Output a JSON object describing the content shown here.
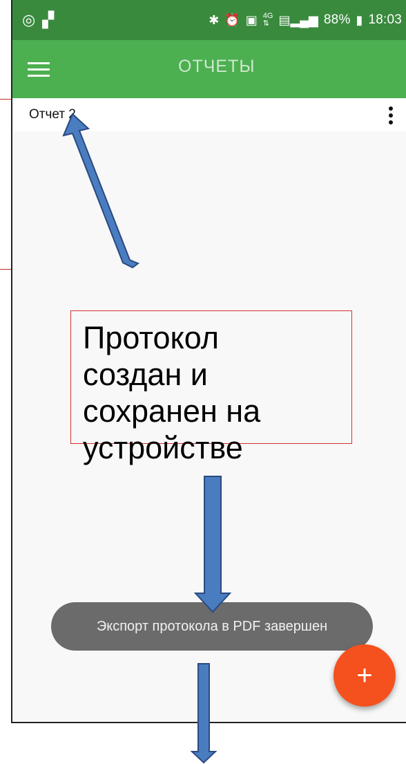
{
  "status_bar": {
    "left_icons": [
      "sync-icon",
      "app-notification-icon"
    ],
    "right_icons": [
      "bluetooth-icon",
      "alarm-icon",
      "sim-icon",
      "4g-icon",
      "signal-icon"
    ],
    "battery": "88%",
    "time": "18:03"
  },
  "app_bar": {
    "title": "ОТЧЕТЫ",
    "menu_icon": "hamburger-menu-icon"
  },
  "list": {
    "items": [
      {
        "label": "Отчет 2"
      }
    ],
    "overflow_icon": "more-vert-icon"
  },
  "toast": {
    "text": "Экспорт протокола в PDF завершен"
  },
  "fab": {
    "label": "+",
    "icon": "plus-icon"
  },
  "annotation": {
    "text": "Протокол создан и сохранен на устройстве"
  },
  "colors": {
    "status_bar": "#3a8a3e",
    "app_bar": "#4caf50",
    "fab": "#f4511e",
    "toast": "#6b6b6b",
    "annotation_border": "#d32f2f",
    "arrow_fill": "#4a7cc0",
    "arrow_stroke": "#2a4a80"
  }
}
